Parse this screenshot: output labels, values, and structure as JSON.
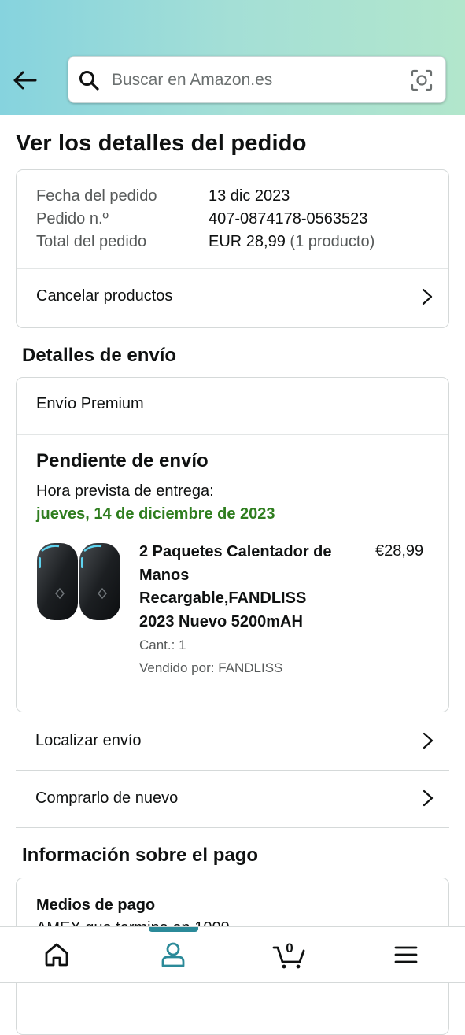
{
  "header": {
    "search_placeholder": "Buscar en Amazon.es"
  },
  "page_title": "Ver los detalles del pedido",
  "order_summary": {
    "date_label": "Fecha del pedido",
    "date_value": "13 dic 2023",
    "number_label": "Pedido n.º",
    "number_value": "407-0874178-0563523",
    "total_label": "Total del pedido",
    "total_value": "EUR 28,99",
    "total_count": "(1 producto)",
    "cancel_label": "Cancelar productos"
  },
  "shipping": {
    "section_title": "Detalles de envío",
    "method": "Envío Premium",
    "status": "Pendiente de envío",
    "eta_label": "Hora prevista de entrega:",
    "eta_date": "jueves, 14 de diciembre de 2023",
    "product": {
      "title": "2 Paquetes Calentador de Manos Recargable,FANDLISS 2023 Nuevo 5200mAH",
      "price": "€28,99",
      "quantity": "Cant.: 1",
      "seller": "Vendido por: FANDLISS"
    },
    "track_label": "Localizar envío",
    "buy_again_label": "Comprarlo de nuevo"
  },
  "payment": {
    "section_title": "Información sobre el pago",
    "methods_title": "Medios de pago",
    "methods_detail": "AMEX que termina en 1009"
  },
  "bottom_nav": {
    "cart_count": "0",
    "items": [
      "home-icon",
      "account-icon",
      "cart-icon",
      "menu-icon"
    ],
    "active": "account-icon",
    "accent_color": "#2b8a99"
  },
  "colors": {
    "delivery_green": "#2e7d1e",
    "header_gradient": [
      "#86d3de",
      "#b2e6cc"
    ]
  }
}
